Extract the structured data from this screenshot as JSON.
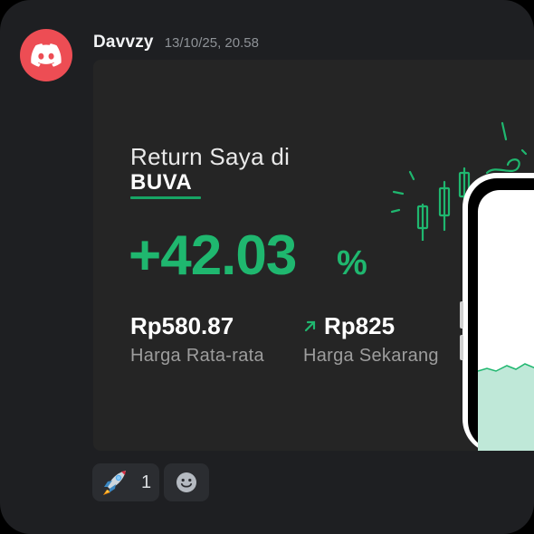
{
  "message": {
    "author": "Davvzy",
    "timestamp": "13/10/25, 20.58",
    "avatar_icon": "discord-logo-icon",
    "avatar_color": "#ed4d54"
  },
  "card": {
    "title": "Return Saya di",
    "ticker": "BUVA",
    "return_value": "+42.03",
    "return_unit": "%",
    "average_price": "Rp580.87",
    "average_label": "Harga Rata-rata",
    "current_price": "Rp825",
    "current_label": "Harga Sekarang",
    "accent_color": "#1fb76f",
    "trend_icon": "arrow-up-right-icon"
  },
  "reactions": [
    {
      "emoji": "rocket-emoji-icon",
      "count": "1"
    },
    {
      "emoji": "add-reaction-icon"
    }
  ]
}
